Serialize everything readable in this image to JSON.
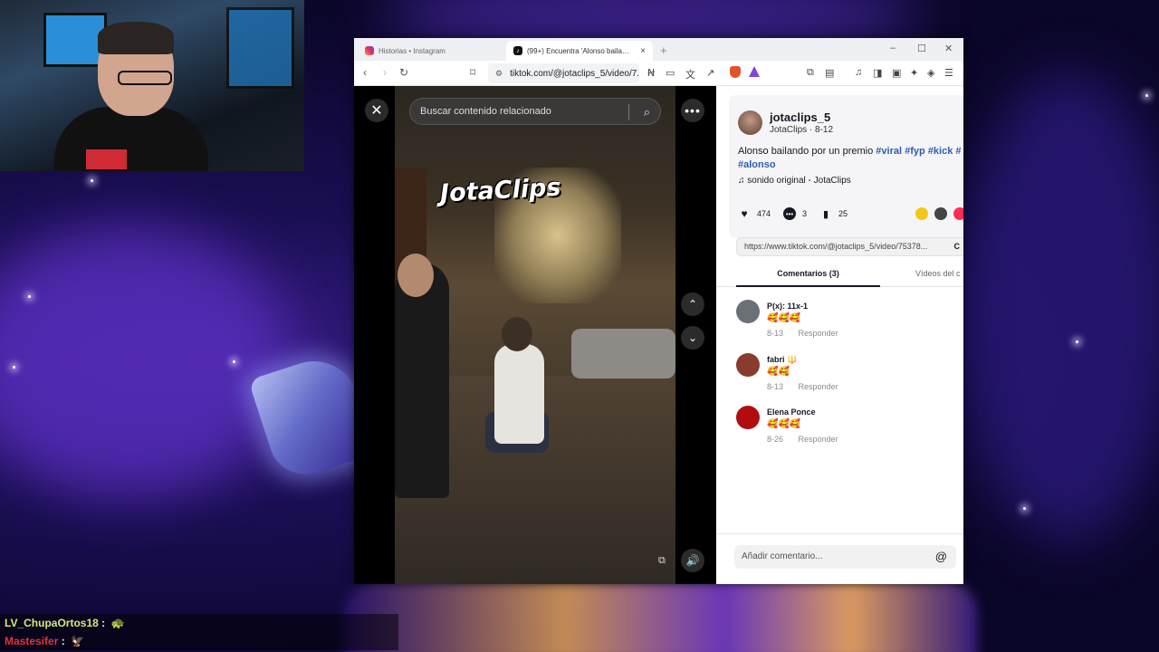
{
  "stream": {
    "chat": [
      {
        "user": "LV_ChupaOrtos18",
        "sep": ":",
        "emote": "🐢"
      },
      {
        "user": "Mastesifer",
        "sep": ":",
        "emote": "🦅"
      }
    ]
  },
  "browser": {
    "tabs": [
      {
        "label": "Historias • Instagram",
        "icon": "instagram-icon"
      },
      {
        "label": "(99+) Encuentra 'Alonso baila…",
        "icon": "tiktok-icon",
        "close": "×"
      }
    ],
    "new_tab": "+",
    "window_controls": {
      "minimize": "–",
      "maximize": "☐",
      "close": "✕"
    },
    "url": "tiktok.com/@jotaclips_5/video/7...",
    "nav": {
      "back": "‹",
      "forward": "›",
      "reload": "↻",
      "bookmark": "⌑"
    }
  },
  "video": {
    "close": "✕",
    "search_placeholder": "Buscar contenido relacionado",
    "watermark": "JotaClips",
    "more": "•••",
    "up": "⌃",
    "down": "⌄",
    "volume": "🔊"
  },
  "post": {
    "username": "jotaclips_5",
    "display_name": "JotaClips",
    "date": "8-12",
    "caption_text": "Alonso bailando por un premio",
    "hashtags": [
      "#viral",
      "#fyp",
      "#kick",
      "#"
    ],
    "hashtag_extra": "#alonso",
    "sound": "sonido original - JotaClips",
    "likes": "474",
    "comments": "3",
    "saves": "25",
    "link": "https://www.tiktok.com/@jotaclips_5/video/75378...",
    "copy": "C",
    "tab_comments": "Comentarios (3)",
    "tab_videos": "Vídeos del c"
  },
  "comments": [
    {
      "name": "P(x): 11x-1",
      "text": "🥰🥰🥰",
      "date": "8-13",
      "reply": "Responder",
      "avatar_color": "#6b7078"
    },
    {
      "name": "fabri 🔱",
      "text": "🥰🥰",
      "date": "8-13",
      "reply": "Responder",
      "avatar_color": "#8a3b2d"
    },
    {
      "name": "Elena Ponce",
      "text": "🥰🥰🥰",
      "date": "8-26",
      "reply": "Responder",
      "avatar_color": "#b10d10"
    }
  ],
  "comment_input": {
    "placeholder": "Añadir comentario...",
    "at": "@"
  },
  "colors": {
    "hashtag": "#2b5db8",
    "brave": "#e2522d",
    "accent": "#fe2c55"
  }
}
